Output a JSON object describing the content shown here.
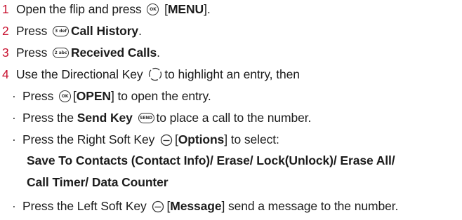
{
  "steps": [
    {
      "number": "1",
      "pre": "Open the flip and press",
      "icon": "ok-key-icon",
      "bracket_open": " [",
      "bold": "MENU",
      "bracket_close": "]."
    },
    {
      "number": "2",
      "pre": "Press",
      "icon": "three-key-icon",
      "key_label": "3 def",
      "bold": "Call History",
      "post": "."
    },
    {
      "number": "3",
      "pre": "Press",
      "icon": "two-key-icon",
      "key_label": "2 abc",
      "bold": "Received Calls",
      "post": "."
    },
    {
      "number": "4",
      "pre": "Use the Directional Key",
      "icon": "directional-key-icon",
      "post": "to highlight an entry, then"
    }
  ],
  "substeps": [
    {
      "bullet": "·",
      "pre": "Press",
      "icon": "ok-key-icon",
      "key_label": "OK",
      "bracket_open": "[",
      "bold": "OPEN",
      "bracket_close": "]",
      "post": " to open the entry."
    },
    {
      "bullet": "·",
      "pre": "Press the ",
      "bold": "Send Key",
      "icon": "send-key-icon",
      "key_label": "SEND",
      "post": "to place a call to the number."
    },
    {
      "bullet": "·",
      "pre": "Press the Right Soft Key",
      "icon": "right-soft-key-icon",
      "bracket_open": "[",
      "bold": "Options",
      "bracket_close": "]",
      "post": " to select:"
    },
    {
      "bullet": "·",
      "pre": "Press the Left Soft Key",
      "icon": "left-soft-key-icon",
      "bracket_open": "[",
      "bold": "Message",
      "bracket_close": "]",
      "post": " send a message to the number."
    }
  ],
  "options_lines": [
    "Save To Contacts (Contact Info)/ Erase/ Lock(Unlock)/ Erase All/",
    "Call Timer/ Data Counter"
  ],
  "colors": {
    "step_number": "#c8102e",
    "text": "#1c1c1c"
  }
}
